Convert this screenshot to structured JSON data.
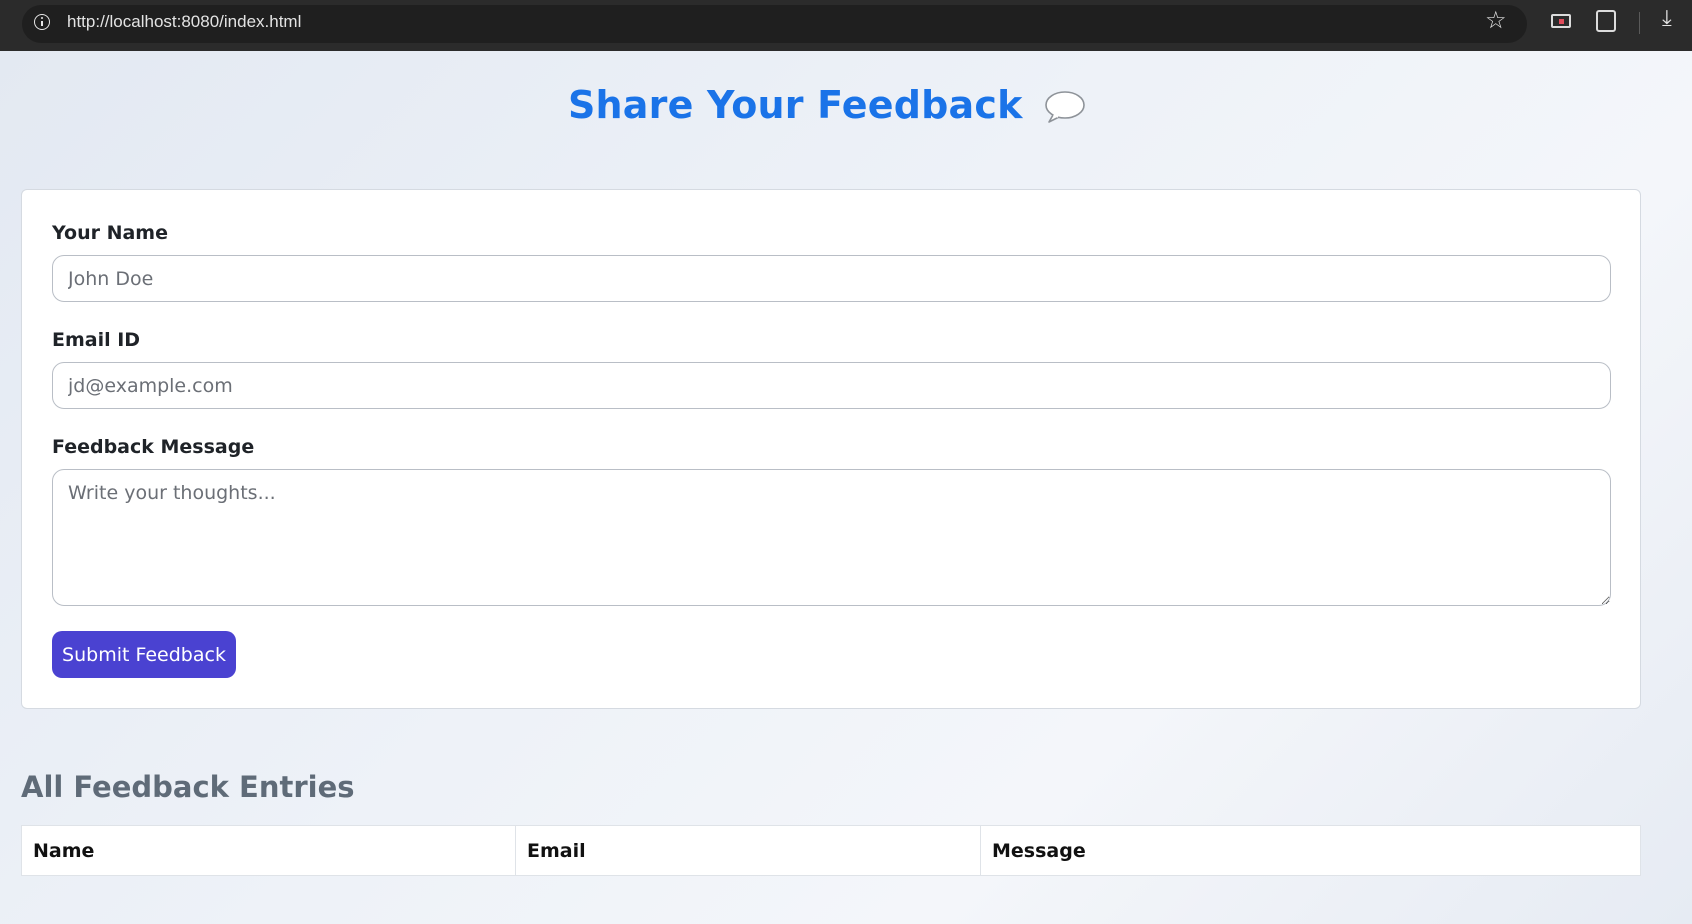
{
  "browser": {
    "url": "http://localhost:8080/index.html"
  },
  "page": {
    "title": "Share Your Feedback",
    "title_icon": "speech-bubble-icon",
    "accent_color": "#1a73e8",
    "button_color": "#4a42d1"
  },
  "form": {
    "name_label": "Your Name",
    "name_placeholder": "John Doe",
    "email_label": "Email ID",
    "email_placeholder": "jd@example.com",
    "message_label": "Feedback Message",
    "message_placeholder": "Write your thoughts...",
    "submit_label": "Submit Feedback"
  },
  "entries": {
    "heading": "All Feedback Entries",
    "columns": [
      "Name",
      "Email",
      "Message"
    ],
    "rows": []
  }
}
